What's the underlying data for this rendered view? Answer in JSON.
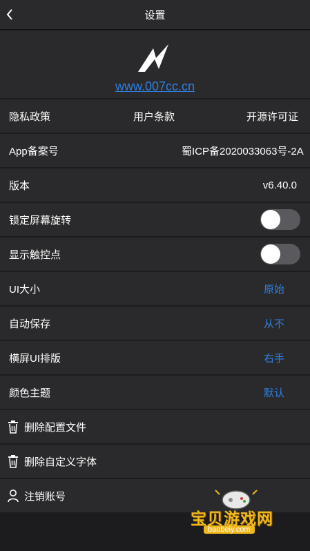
{
  "header": {
    "title": "设置"
  },
  "logo": {
    "link": "www.007cc.cn"
  },
  "policies": {
    "privacy": "隐私政策",
    "terms": "用户条款",
    "license": "开源许可证"
  },
  "icp": {
    "label": "App备案号",
    "value": "蜀ICP备2020033063号-2A"
  },
  "version": {
    "label": "版本",
    "value": "v6.40.0"
  },
  "lock_rotation": {
    "label": "锁定屏幕旋转",
    "enabled": false
  },
  "show_touch": {
    "label": "显示触控点",
    "enabled": false
  },
  "ui_size": {
    "label": "UI大小",
    "value": "原始"
  },
  "autosave": {
    "label": "自动保存",
    "value": "从不"
  },
  "landscape_layout": {
    "label": "横屏UI排版",
    "value": "右手"
  },
  "theme": {
    "label": "颜色主题",
    "value": "默认"
  },
  "delete_config": {
    "label": "删除配置文件"
  },
  "delete_font": {
    "label": "删除自定义字体"
  },
  "logout": {
    "label": "注销账号"
  },
  "watermark": {
    "name": "宝贝游戏网",
    "url": "baobeiy.com"
  },
  "colors": {
    "accent": "#2f7fe0",
    "row_bg": "#2a2a2c",
    "divider": "#111111"
  }
}
